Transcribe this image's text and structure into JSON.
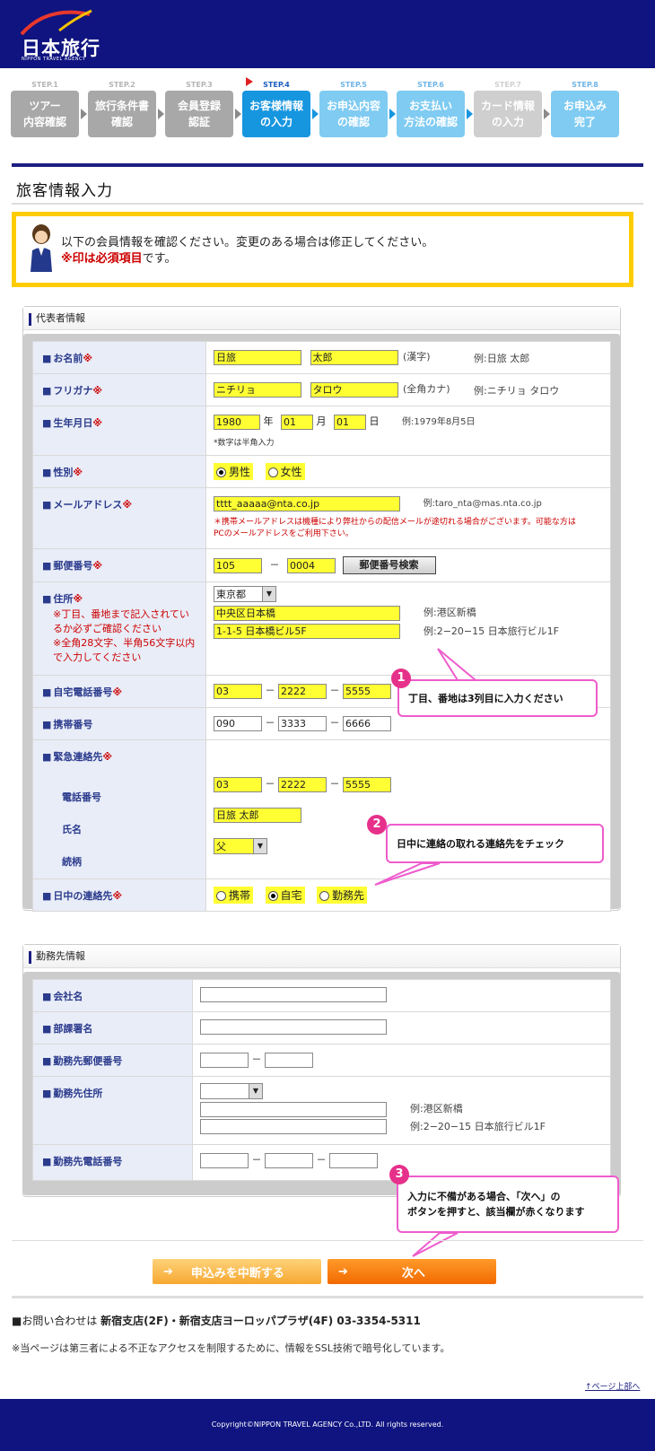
{
  "header": {
    "logo_text": "日本旅行",
    "logo_sub": "NIPPON TRAVEL AGENCY"
  },
  "steps": [
    {
      "num": "STEP.1",
      "label": "ツアー\n内容確認",
      "state": "done"
    },
    {
      "num": "STEP.2",
      "label": "旅行条件書\n確認",
      "state": "done"
    },
    {
      "num": "STEP.3",
      "label": "会員登録\n認証",
      "state": "done"
    },
    {
      "num": "STEP.4",
      "label": "お客様情報\nの入力",
      "state": "current"
    },
    {
      "num": "STEP.5",
      "label": "お申込内容\nの確認",
      "state": "next"
    },
    {
      "num": "STEP.6",
      "label": "お支払い\n方法の確認",
      "state": "next"
    },
    {
      "num": "STEP.7",
      "label": "カード情報\nの入力",
      "state": "disabled"
    },
    {
      "num": "STEP.8",
      "label": "お申込み\n完了",
      "state": "next"
    }
  ],
  "page_title": "旅客情報入力",
  "notice": {
    "line1": "以下の会員情報を確認ください。変更のある場合は修正してください。",
    "line2_red": "※印は必須項目",
    "line2_rest": "です。"
  },
  "representative": {
    "section_title": "代表者情報",
    "name": {
      "label": "お名前",
      "req": "※",
      "last": "日旅",
      "first": "太郎",
      "note": "(漢字)",
      "example": "例:日旅 太郎"
    },
    "furigana": {
      "label": "フリガナ",
      "req": "※",
      "last": "ニチリョ",
      "first": "タロウ",
      "note": "(全角カナ)",
      "example": "例:ニチリョ タロウ"
    },
    "birth": {
      "label": "生年月日",
      "req": "※",
      "year": "1980",
      "year_unit": "年",
      "month": "01",
      "month_unit": "月",
      "day": "01",
      "day_unit": "日",
      "example": "例:1979年8月5日",
      "hint": "*数字は半角入力"
    },
    "gender": {
      "label": "性別",
      "req": "※",
      "male": "男性",
      "female": "女性"
    },
    "email": {
      "label": "メールアドレス",
      "req": "※",
      "value": "tttt_aaaaa@nta.co.jp",
      "example": "例:taro_nta@mas.nta.co.jp",
      "warning": "＊携帯メールアドレスは機種により弊社からの配信メールが途切れる場合がございます。可能な方はPCのメールアドレスをご利用下さい。"
    },
    "postal": {
      "label": "郵便番号",
      "req": "※",
      "part1": "105",
      "dash": "－",
      "part2": "0004",
      "search_button": "郵便番号検索"
    },
    "address": {
      "label": "住所",
      "req": "※",
      "note": "※丁目、番地まで記入されているか必ずご確認ください\n※全角28文字、半角56文字以内で入力してください",
      "prefecture": "東京都",
      "line1": "中央区日本橋",
      "line2": "1-1-5 日本橋ビル5F",
      "example1": "例:港区新橋",
      "example2": "例:2−20−15 日本旅行ビル1F"
    },
    "home_phone": {
      "label": "自宅電話番号",
      "req": "※",
      "p1": "03",
      "p2": "2222",
      "p3": "5555"
    },
    "mobile": {
      "label": "携帯番号",
      "p1": "090",
      "p2": "3333",
      "p3": "6666"
    },
    "emergency": {
      "label": "緊急連絡先",
      "req": "※",
      "phone_label": "電話番号",
      "p1": "03",
      "p2": "2222",
      "p3": "5555",
      "name_label": "氏名",
      "name": "日旅 太郎",
      "relation_label": "続柄",
      "relation": "父"
    },
    "daytime": {
      "label": "日中の連絡先",
      "req": "※",
      "opt1": "携帯",
      "opt2": "自宅",
      "opt3": "勤務先"
    }
  },
  "work": {
    "section_title": "勤務先情報",
    "company": "会社名",
    "department": "部課署名",
    "postal": "勤務先郵便番号",
    "address": "勤務先住所",
    "address_example1": "例:港区新橋",
    "address_example2": "例:2−20−15 日本旅行ビル1F",
    "phone": "勤務先電話番号"
  },
  "callouts": {
    "c1_num": "1",
    "c1_text": "丁目、番地は3列目に入力ください",
    "c2_num": "2",
    "c2_text": "日中に連絡の取れる連絡先をチェック",
    "c3_num": "3",
    "c3_text": "入力に不備がある場合、「次へ」の\nボタンを押すと、該当欄が赤くなります"
  },
  "buttons": {
    "cancel": "申込みを中断する",
    "next": "次へ"
  },
  "footer": {
    "contact_prefix": "■お問い合わせは",
    "contact_detail": "新宿支店(2F)・新宿支店ヨーロッパプラザ(4F) 03-3354-5311",
    "ssl": "※当ページは第三者による不正なアクセスを制限するために、情報をSSL技術で暗号化しています。",
    "page_top": "↑ページ上部へ",
    "copyright": "Copyright©NIPPON TRAVEL AGENCY Co.,LTD. All rights reserved."
  },
  "colors": {
    "header_blue": "#0f1480",
    "required_red": "#cc0000",
    "highlight_yellow": "#ffff33",
    "callout_pink": "#e6318a",
    "notice_border": "#ffcc00"
  }
}
